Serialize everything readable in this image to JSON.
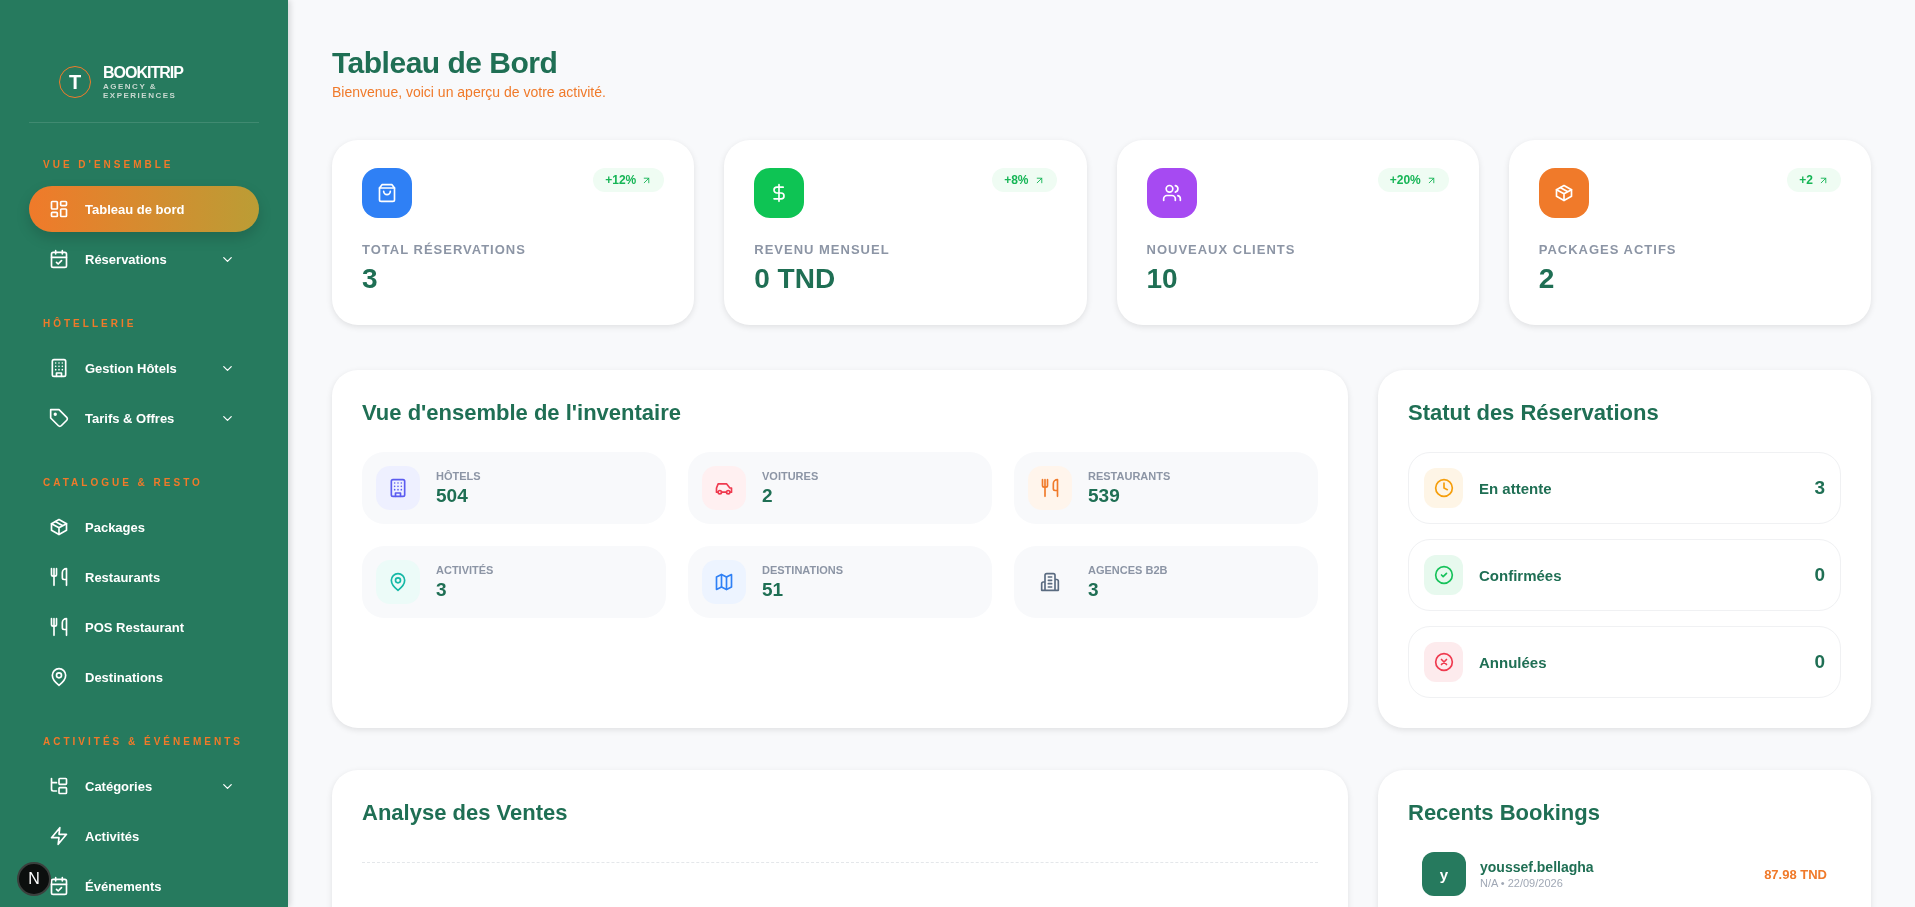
{
  "sidebar": {
    "logo": {
      "mark": "T",
      "name": "BOOKITRIP",
      "tagline": "AGENCY & EXPERIENCES"
    },
    "sections": [
      {
        "title": "VUE D'ENSEMBLE",
        "items": [
          {
            "label": "Tableau de bord",
            "selected": true,
            "has_submenu": false
          },
          {
            "label": "Réservations",
            "selected": false,
            "has_submenu": true
          }
        ]
      },
      {
        "title": "HÔTELLERIE",
        "items": [
          {
            "label": "Gestion Hôtels",
            "selected": false,
            "has_submenu": true
          },
          {
            "label": "Tarifs & Offres",
            "selected": false,
            "has_submenu": true
          }
        ]
      },
      {
        "title": "CATALOGUE & RESTO",
        "items": [
          {
            "label": "Packages",
            "selected": false,
            "has_submenu": false
          },
          {
            "label": "Restaurants",
            "selected": false,
            "has_submenu": false
          },
          {
            "label": "POS Restaurant",
            "selected": false,
            "has_submenu": false
          },
          {
            "label": "Destinations",
            "selected": false,
            "has_submenu": false
          }
        ]
      },
      {
        "title": "ACTIVITÉS & ÉVÉNEMENTS",
        "items": [
          {
            "label": "Catégories",
            "selected": false,
            "has_submenu": true
          },
          {
            "label": "Activités",
            "selected": false,
            "has_submenu": false
          },
          {
            "label": "Événements",
            "selected": false,
            "has_submenu": false
          }
        ]
      }
    ]
  },
  "dev_badge": "N",
  "header": {
    "title": "Tableau de Bord",
    "subtitle": "Bienvenue, voici un aperçu de votre activité."
  },
  "stats": [
    {
      "label": "TOTAL RÉSERVATIONS",
      "value": "3",
      "change": "+12%",
      "color": "#2f80f5"
    },
    {
      "label": "REVENU MENSUEL",
      "value": "0 TND",
      "change": "+8%",
      "color": "#0ec454"
    },
    {
      "label": "NOUVEAUX CLIENTS",
      "value": "10",
      "change": "+20%",
      "color": "#a64af2"
    },
    {
      "label": "PACKAGES ACTIFS",
      "value": "2",
      "change": "+2",
      "color": "#f07a2a"
    }
  ],
  "inventory": {
    "title": "Vue d'ensemble de l'inventaire",
    "items": [
      {
        "label": "HÔTELS",
        "value": "504"
      },
      {
        "label": "VOITURES",
        "value": "2"
      },
      {
        "label": "RESTAURANTS",
        "value": "539"
      },
      {
        "label": "ACTIVITÉS",
        "value": "3"
      },
      {
        "label": "DESTINATIONS",
        "value": "51"
      },
      {
        "label": "AGENCES B2B",
        "value": "3"
      }
    ]
  },
  "booking_status": {
    "title": "Statut des Réservations",
    "rows": [
      {
        "label": "En attente",
        "count": "3",
        "color": "#f59e0b"
      },
      {
        "label": "Confirmées",
        "count": "0",
        "color": "#16c25a"
      },
      {
        "label": "Annulées",
        "count": "0",
        "color": "#ef3a4f"
      }
    ]
  },
  "sales": {
    "title": "Analyse des Ventes"
  },
  "recent_bookings": {
    "title": "Recents Bookings",
    "items": [
      {
        "initial": "y",
        "name": "youssef.bellagha",
        "meta": "N/A • 22/09/2026",
        "amount": "87.98 TND"
      }
    ]
  }
}
